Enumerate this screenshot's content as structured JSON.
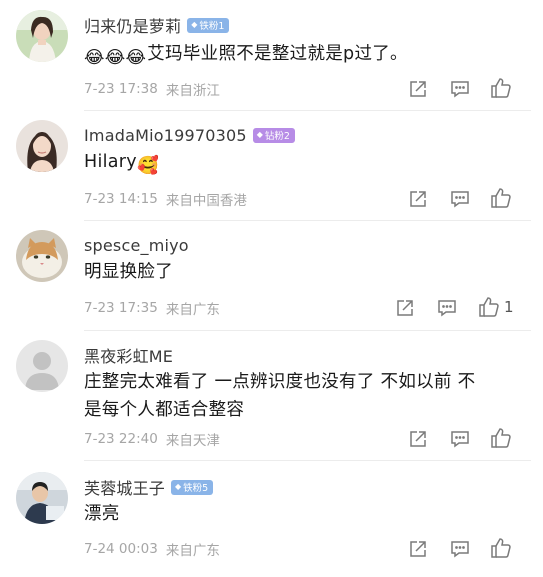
{
  "comments": [
    {
      "username": "归来仍是萝莉",
      "badge": {
        "text": "铁粉1",
        "color": "#8ab4e8"
      },
      "emojis": "😂😂😂",
      "text": "艾玛毕业照不是整过就是p过了。",
      "time": "7-23 17:38",
      "location": "来自浙江",
      "likes": ""
    },
    {
      "username": "ImadaMio19970305",
      "badge": {
        "text": "钻粉2",
        "color": "#b78ce6"
      },
      "text": "Hilary",
      "emoji_after": "🥰",
      "time": "7-23 14:15",
      "location": "来自中国香港",
      "likes": ""
    },
    {
      "username": "spesce_miyo",
      "badge": null,
      "text": "明显换脸了",
      "time": "7-23 17:35",
      "location": "来自广东",
      "likes": "1"
    },
    {
      "username": "黑夜彩虹ME",
      "badge": null,
      "text_line1": "庄整完太难看了 一点辨识度也没有了 不如以前 不",
      "text_line2": "是每个人都适合整容",
      "time": "7-23 22:40",
      "location": "来自天津",
      "likes": ""
    },
    {
      "username": "芙蓉城王子",
      "badge": {
        "text": "铁粉5",
        "color": "#8ab4e8"
      },
      "text": "漂亮",
      "time": "7-24 00:03",
      "location": "来自广东",
      "likes": ""
    }
  ],
  "icons": {
    "share": "share-icon",
    "comment": "comment-icon",
    "like": "thumb-up-icon",
    "badge_gem": "diamond-icon"
  }
}
